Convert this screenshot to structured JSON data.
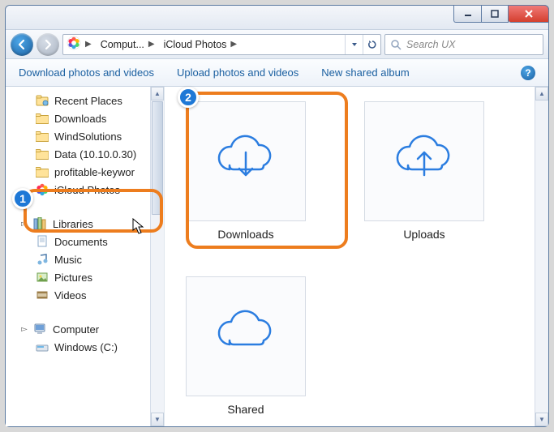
{
  "breadcrumb": {
    "seg1": "Comput...",
    "seg2": "iCloud Photos"
  },
  "search": {
    "placeholder": "Search UX"
  },
  "toolbar": {
    "download": "Download photos and videos",
    "upload": "Upload photos and videos",
    "newalbum": "New shared album"
  },
  "sidebar": {
    "items": [
      {
        "label": "Recent Places"
      },
      {
        "label": "Downloads"
      },
      {
        "label": "WindSolutions"
      },
      {
        "label": "Data (10.10.0.30)"
      },
      {
        "label": "profitable-keywor"
      },
      {
        "label": "iCloud Photos"
      }
    ],
    "groups": {
      "libraries": "Libraries",
      "computer": "Computer"
    },
    "libs": [
      {
        "label": "Documents"
      },
      {
        "label": "Music"
      },
      {
        "label": "Pictures"
      },
      {
        "label": "Videos"
      }
    ],
    "drives": [
      {
        "label": "Windows (C:)"
      }
    ]
  },
  "main": {
    "items": [
      {
        "label": "Downloads"
      },
      {
        "label": "Uploads"
      },
      {
        "label": "Shared"
      }
    ]
  },
  "annotations": {
    "one": "1",
    "two": "2"
  }
}
